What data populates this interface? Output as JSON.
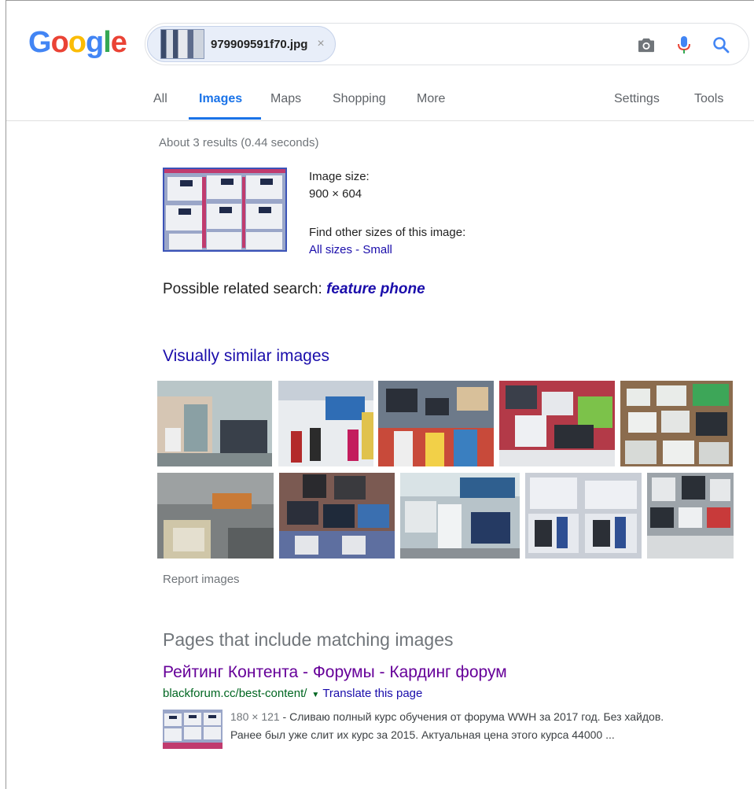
{
  "logo": {
    "letters": [
      "G",
      "o",
      "o",
      "g",
      "l",
      "e"
    ],
    "colors": [
      "#4285F4",
      "#EA4335",
      "#FBBC05",
      "#4285F4",
      "#34A853",
      "#EA4335"
    ]
  },
  "search": {
    "file_name": "979909591f70.jpg",
    "clear": "×"
  },
  "icons": {
    "camera": "camera-icon",
    "mic": "microphone-icon",
    "search": "search-icon"
  },
  "tabs": [
    {
      "label": "All"
    },
    {
      "label": "Images"
    },
    {
      "label": "Maps"
    },
    {
      "label": "Shopping"
    },
    {
      "label": "More"
    }
  ],
  "right_tabs": {
    "settings": "Settings",
    "tools": "Tools"
  },
  "stats": "About 3 results (0.44 seconds)",
  "image_info": {
    "size_label": "Image size:",
    "size_value": "900 × 604",
    "other_sizes_label": "Find other sizes of this image:",
    "all_sizes": "All sizes",
    "sep": " - ",
    "small": "Small"
  },
  "related": {
    "label": "Possible related search: ",
    "query": "feature phone"
  },
  "similar": {
    "heading": "Visually similar images",
    "report": "Report images"
  },
  "pages": {
    "heading": "Pages that include matching images",
    "results": [
      {
        "title": "Рейтинг Контента - Форумы - Кардинг форум",
        "url": "blackforum.cc/best-content/",
        "translate": "Translate this page",
        "dims": "180 × 121",
        "snippet_line1": " - Сливаю полный курс обучения от форума WWH за 2017 год. Без хайдов.",
        "snippet_line2": "Ранее был уже слит их курс за 2015. Актуальная цена этого курса 44000 ..."
      }
    ]
  }
}
